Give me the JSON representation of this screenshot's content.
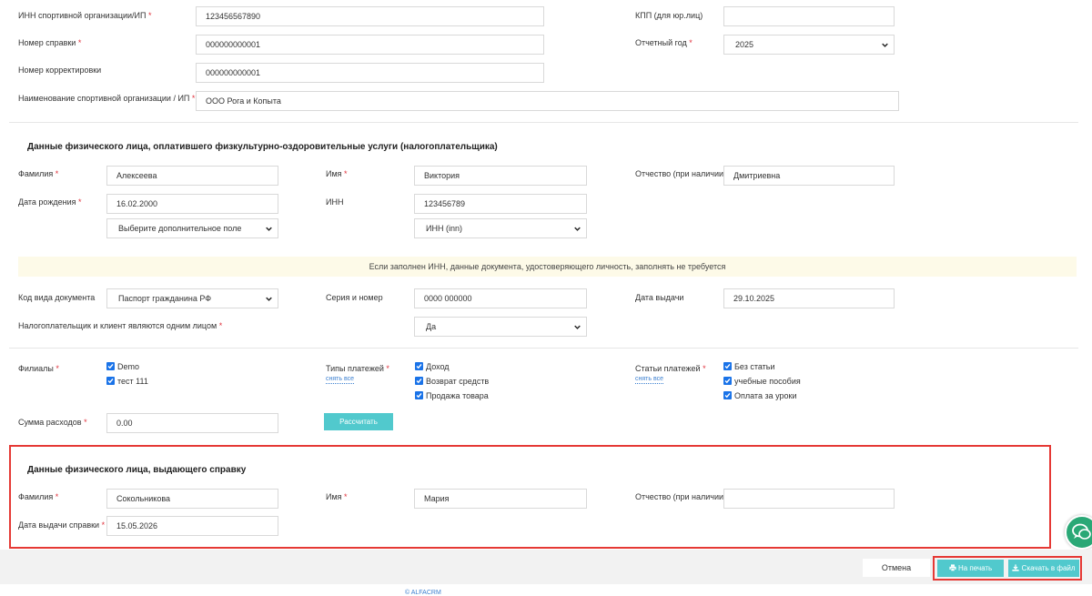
{
  "org": {
    "inn_label": "ИНН спортивной организации/ИП",
    "inn_value": "123456567890",
    "kpp_label": "КПП (для юр.лиц)",
    "kpp_value": "",
    "cert_no_label": "Номер справки",
    "cert_no_value": "000000000001",
    "year_label": "Отчетный год",
    "year_value": "2025",
    "corr_label": "Номер корректировки",
    "corr_value": "000000000001",
    "name_label": "Наименование спортивной организации / ИП",
    "name_value": "ООО Рога и Копыта"
  },
  "payer": {
    "heading": "Данные физического лица, оплатившего физкультурно-оздоровительные услуги (налогоплательщика)",
    "surname_label": "Фамилия",
    "surname_value": "Алексеева",
    "name_label": "Имя",
    "name_value": "Виктория",
    "patronymic_label": "Отчество (при наличии)",
    "patronymic_value": "Дмитриевна",
    "dob_label": "Дата рождения",
    "dob_value": "16.02.2000",
    "inn_label": "ИНН",
    "inn_value": "123456789",
    "extra_field_select": "Выберите дополнительное поле",
    "inn_type_select": "ИНН (inn)",
    "notice": "Если заполнен ИНН, данные документа, удостоверяющего личность, заполнять не требуется",
    "doc_code_label": "Код вида документа",
    "doc_code_value": "Паспорт гражданина РФ",
    "series_label": "Серия и номер",
    "series_value": "0000 000000",
    "issue_date_label": "Дата выдачи",
    "issue_date_value": "29.10.2025",
    "same_person_label": "Налогоплательщик и клиент являются одним лицом",
    "same_person_value": "Да"
  },
  "filters": {
    "branches_label": "Филиалы",
    "branches": [
      "Demo",
      "тест 111"
    ],
    "payment_types_label": "Типы платежей",
    "payment_types_clear": "снять все",
    "payment_types": [
      "Доход",
      "Возврат средств",
      "Продажа товара"
    ],
    "payment_items_label": "Статьи платежей",
    "payment_items_clear": "снять все",
    "payment_items": [
      "Без статьи",
      "учебные пособия",
      "Оплата за уроки"
    ],
    "sum_label": "Сумма расходов",
    "sum_value": "0.00",
    "calc_button": "Рассчитать"
  },
  "issuer": {
    "heading": "Данные физического лица, выдающего справку",
    "surname_label": "Фамилия",
    "surname_value": "Сокольникова",
    "name_label": "Имя",
    "name_value": "Мария",
    "patronymic_label": "Отчество (при наличии)",
    "patronymic_value": "",
    "date_label": "Дата выдачи справки",
    "date_value": "15.05.2026"
  },
  "actions": {
    "cancel": "Отмена",
    "print": "На печать",
    "download": "Скачать в файл"
  },
  "footer": {
    "text": "© ALFACRM"
  },
  "colors": {
    "accent": "#51c9cd",
    "required": "#e0343e",
    "highlight_border": "#e53935",
    "checkbox": "#1a73e8",
    "chat": "#2aa876"
  }
}
